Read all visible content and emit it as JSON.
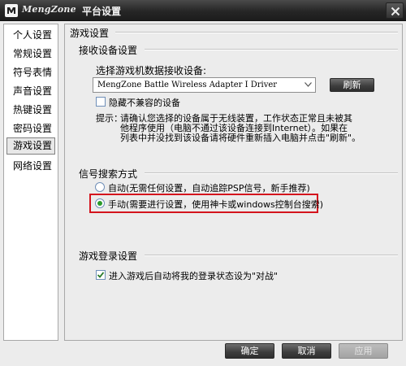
{
  "window": {
    "brand": "MengZone",
    "title": "平台设置",
    "logo_icon": "mengzone-logo-icon",
    "close_icon": "close-icon"
  },
  "sidebar": {
    "items": [
      {
        "label": "个人设置",
        "active": false
      },
      {
        "label": "常规设置",
        "active": false
      },
      {
        "label": "符号表情",
        "active": false
      },
      {
        "label": "声音设置",
        "active": false
      },
      {
        "label": "热键设置",
        "active": false
      },
      {
        "label": "密码设置",
        "active": false
      },
      {
        "label": "游戏设置",
        "active": true
      },
      {
        "label": "网络设置",
        "active": false
      }
    ]
  },
  "content": {
    "page_title": "游戏设置",
    "receiver": {
      "section_title": "接收设备设置",
      "select_label": "选择游戏机数据接收设备:",
      "device_value": "MengZone Battle Wireless Adapter I Driver",
      "refresh_label": "刷新",
      "hide_incompatible_label": "隐藏不兼容的设备",
      "hide_incompatible_checked": false,
      "hint_prefix": "提示：",
      "hint_lines": [
        "请确认您选择的设备属于无线装置，工作状态正常且未被其",
        "他程序使用（电脑不通过该设备连接到Internet）。如果在",
        "列表中并没找到该设备请将硬件重新插入电脑并点击\"刷新\"。"
      ]
    },
    "signal": {
      "section_title": "信号搜索方式",
      "options": [
        {
          "label": "自动(无需任何设置，自动追踪PSP信号，新手推荐)",
          "selected": false
        },
        {
          "label": "手动(需要进行设置，使用神卡或windows控制台搜索)",
          "selected": true
        }
      ],
      "highlight_color": "#d4141d"
    },
    "login": {
      "section_title": "游戏登录设置",
      "auto_battle_label": "进入游戏后自动将我的登录状态设为\"对战\"",
      "auto_battle_checked": true
    }
  },
  "footer": {
    "ok_label": "确定",
    "cancel_label": "取消",
    "apply_label": "应用",
    "apply_enabled": false
  },
  "colors": {
    "titlebar": "#262626",
    "panel_bg": "#ececec",
    "button_dark": "#3c3c3c",
    "check_mark": "#2a7a2a"
  }
}
